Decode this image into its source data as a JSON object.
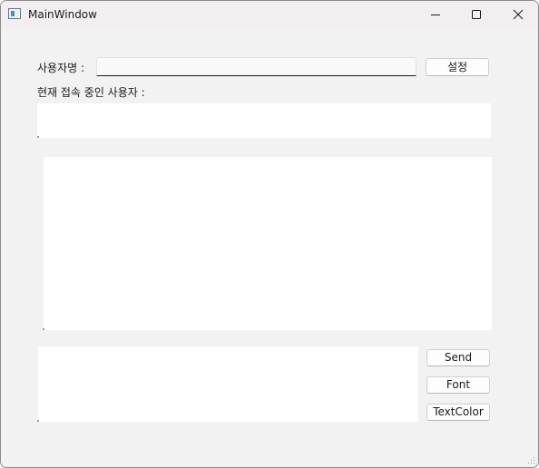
{
  "window": {
    "title": "MainWindow",
    "controls": {
      "minimize_icon": "minimize-icon",
      "maximize_icon": "maximize-icon",
      "close_icon": "close-icon"
    }
  },
  "username_row": {
    "label": "사용자명 :",
    "input_value": "",
    "set_button": "설정"
  },
  "online_users": {
    "label": "현재 접속 중인 사용자 :",
    "items": []
  },
  "chat_log": {
    "messages": []
  },
  "compose": {
    "message_value": "",
    "send_button": "Send",
    "font_button": "Font",
    "text_color_button": "TextColor"
  },
  "colors": {
    "window_bg": "#f2f2f2",
    "titlebar_bg": "#f3eff0",
    "field_bg": "#ffffff",
    "button_bg": "#fdfdfd"
  }
}
